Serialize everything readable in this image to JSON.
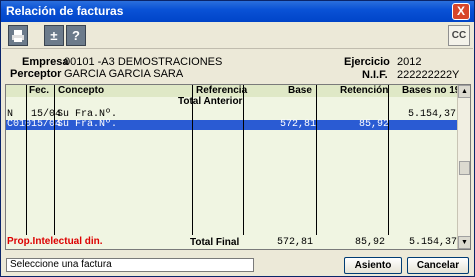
{
  "window": {
    "title": "Relación de facturas",
    "close_label": "X"
  },
  "toolbar": {
    "print_icon": "printer-icon",
    "plusminus_label": "±",
    "help_label": "?",
    "cc_label": "CC"
  },
  "info": {
    "empresa_label": "Empresa",
    "empresa_value": "00101 -A3 DEMOSTRACIONES",
    "perceptor_label": "Perceptor",
    "perceptor_value": "GARCIA GARCIA SARA",
    "ejercicio_label": "Ejercicio",
    "ejercicio_value": "2012",
    "nif_label": "N.I.F.",
    "nif_value": "222222222Y"
  },
  "grid": {
    "columns": [
      "Fec.",
      "Concepto",
      "Referencia",
      "Base",
      "Retención",
      "Bases no 193"
    ],
    "total_anterior_label": "Total Anterior",
    "rows": [
      {
        "code": "N",
        "fec": "15/04",
        "concepto": "Su Fra.Nº.",
        "referencia": "",
        "base": "",
        "retencion": "",
        "bases_no_193": "5.154,37",
        "selected": false
      },
      {
        "code": "C010",
        "fec": "15/04",
        "concepto": "Su Fra.Nº.",
        "referencia": "",
        "base": "572,81",
        "retencion": "85,92",
        "bases_no_193": "",
        "selected": true
      }
    ]
  },
  "footer": {
    "prop_label": "Prop.Intelectual din.",
    "total_final_label": "Total Final",
    "total_base": "572,81",
    "total_retencion": "85,92",
    "total_bases_no_193": "5.154,37"
  },
  "status": {
    "text": "Seleccione una factura"
  },
  "buttons": {
    "asiento": "Asiento",
    "cancelar": "Cancelar"
  },
  "colors": {
    "selection": "#2a5bd3",
    "grid_bg": "#f0f5e2",
    "prop_text": "#dd0000"
  }
}
